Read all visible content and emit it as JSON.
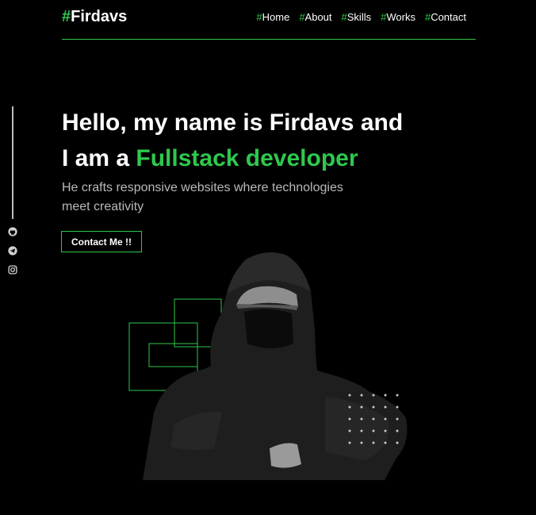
{
  "header": {
    "logo_hash": "#",
    "logo_text": "Firdavs",
    "nav": [
      {
        "hash": "#",
        "label": "Home"
      },
      {
        "hash": "#",
        "label": "About"
      },
      {
        "hash": "#",
        "label": "Skills"
      },
      {
        "hash": "#",
        "label": "Works"
      },
      {
        "hash": "#",
        "label": "Contact"
      }
    ]
  },
  "social": [
    "github-icon",
    "telegram-icon",
    "instagram-icon"
  ],
  "hero": {
    "line1": "Hello, my name is Firdavs and",
    "line2_prefix": "I am a ",
    "line2_highlight": "Fullstack developer",
    "subtitle": "He crafts responsive websites where technologies meet creativity",
    "cta_label": "Contact Me !!"
  },
  "colors": {
    "accent": "#2ec84d",
    "background": "#000000",
    "muted": "#b9b9b9"
  }
}
